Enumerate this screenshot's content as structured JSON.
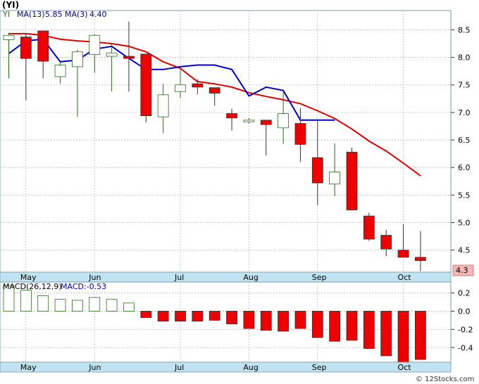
{
  "title": "(YI)",
  "legend": {
    "symbol": "YI",
    "ma13_label": "MA(13)",
    "ma13_value": "5.85",
    "ma3_label": "MA(3)",
    "ma3_value": "4.40",
    "ma13_color": "#e00000",
    "ma3_color": "#0000cc"
  },
  "last_price_label": "4.3",
  "macd_legend": {
    "params": "MACD(26,12,9)",
    "value": "MACD:-0.53"
  },
  "watermark": "© 12Stocks.com",
  "colors": {
    "up": "#ffffff",
    "up_border": "#2e6b1f",
    "down": "#ee0000",
    "macd_pos": "#2e6b1f",
    "macd_neg": "#ee0000",
    "axis_band": "#bfe3f0"
  },
  "chart_data": [
    {
      "type": "candlestick",
      "period": "weekly",
      "x_tick_labels": [
        "May",
        "Jun",
        "Jul",
        "Aug",
        "Sep",
        "Oct"
      ],
      "x_tick_week_index": [
        1,
        5,
        10,
        14,
        18,
        23
      ],
      "y_tick_labels": [
        "4.5",
        "5.0",
        "5.5",
        "6.0",
        "6.5",
        "7.0",
        "7.5",
        "8.0",
        "8.5"
      ],
      "ylim": [
        4.1,
        8.85
      ],
      "grid": true,
      "candles": [
        {
          "o": 8.32,
          "h": 8.45,
          "l": 7.62,
          "c": 8.4
        },
        {
          "o": 8.37,
          "h": 8.44,
          "l": 7.22,
          "c": 7.98
        },
        {
          "o": 8.48,
          "h": 8.48,
          "l": 7.62,
          "c": 7.93
        },
        {
          "o": 7.65,
          "h": 7.92,
          "l": 7.52,
          "c": 7.86
        },
        {
          "o": 7.83,
          "h": 8.14,
          "l": 6.92,
          "c": 8.1
        },
        {
          "o": 8.05,
          "h": 8.42,
          "l": 7.72,
          "c": 8.4
        },
        {
          "o": 8.02,
          "h": 8.26,
          "l": 7.38,
          "c": 8.08
        },
        {
          "o": 8.02,
          "h": 8.65,
          "l": 7.38,
          "c": 7.98
        },
        {
          "o": 8.06,
          "h": 8.06,
          "l": 6.82,
          "c": 6.94
        },
        {
          "o": 6.92,
          "h": 7.52,
          "l": 6.62,
          "c": 7.32
        },
        {
          "o": 7.38,
          "h": 7.78,
          "l": 7.26,
          "c": 7.5
        },
        {
          "o": 7.52,
          "h": 7.6,
          "l": 7.33,
          "c": 7.46
        },
        {
          "o": 7.45,
          "h": 7.45,
          "l": 7.12,
          "c": 7.35
        },
        {
          "o": 6.98,
          "h": 7.07,
          "l": 6.67,
          "c": 6.9
        },
        {
          "o": 6.83,
          "h": 6.9,
          "l": 6.8,
          "c": 6.86
        },
        {
          "o": 6.86,
          "h": 6.86,
          "l": 6.22,
          "c": 6.78
        },
        {
          "o": 6.72,
          "h": 7.38,
          "l": 6.43,
          "c": 6.98
        },
        {
          "o": 6.8,
          "h": 7.08,
          "l": 6.1,
          "c": 6.42
        },
        {
          "o": 6.18,
          "h": 6.85,
          "l": 5.32,
          "c": 5.72
        },
        {
          "o": 5.7,
          "h": 6.44,
          "l": 5.48,
          "c": 5.92
        },
        {
          "o": 6.28,
          "h": 6.36,
          "l": 5.22,
          "c": 5.23
        },
        {
          "o": 5.12,
          "h": 5.18,
          "l": 4.67,
          "c": 4.7
        },
        {
          "o": 4.77,
          "h": 4.87,
          "l": 4.39,
          "c": 4.52
        },
        {
          "o": 4.5,
          "h": 4.97,
          "l": 4.38,
          "c": 4.37
        },
        {
          "o": 4.37,
          "h": 4.85,
          "l": 4.12,
          "c": 4.31
        }
      ],
      "ma13": [
        null,
        null,
        null,
        null,
        null,
        null,
        8.31,
        8.29,
        8.18,
        8.05,
        7.92,
        7.8,
        7.67,
        7.53,
        7.38,
        7.24,
        7.09,
        6.92,
        6.72,
        6.52,
        6.3,
        6.08,
        5.85
      ],
      "ma3": [
        8.07,
        8.3,
        8.33,
        7.92,
        7.95,
        8.15,
        8.2,
        7.98,
        7.78,
        7.78,
        7.83,
        7.86,
        7.86,
        7.78,
        7.3,
        7.46,
        7.4,
        null,
        null,
        null,
        null,
        null,
        null,
        null,
        null
      ],
      "ma13_full": [
        8.43,
        8.43,
        8.4,
        8.33,
        8.3,
        8.28,
        8.25,
        8.2,
        8.1,
        7.92,
        7.8,
        7.56,
        7.52,
        7.46,
        7.36,
        7.29,
        7.23,
        7.16,
        7.03,
        6.89,
        6.7,
        6.48,
        6.3,
        6.08,
        5.85
      ],
      "ma3_full": [
        8.07,
        8.3,
        8.33,
        7.92,
        7.95,
        8.15,
        8.2,
        7.98,
        7.78,
        7.78,
        7.83,
        7.86,
        7.86,
        7.78,
        7.3,
        7.46,
        7.4,
        6.86,
        6.86,
        6.86,
        null,
        null,
        null,
        null,
        null
      ]
    },
    {
      "type": "bar",
      "name": "MACD(26,12,9)",
      "y_tick_labels": [
        "0.2",
        "0.0",
        "-0.2",
        "-0.4"
      ],
      "ylim": [
        -0.56,
        0.32
      ],
      "values": [
        0.28,
        0.23,
        0.17,
        0.13,
        0.12,
        0.15,
        0.13,
        0.09,
        -0.07,
        -0.11,
        -0.11,
        -0.11,
        -0.1,
        -0.14,
        -0.19,
        -0.21,
        -0.22,
        -0.19,
        -0.29,
        -0.33,
        -0.32,
        -0.41,
        -0.49,
        -0.56,
        -0.53
      ]
    }
  ]
}
